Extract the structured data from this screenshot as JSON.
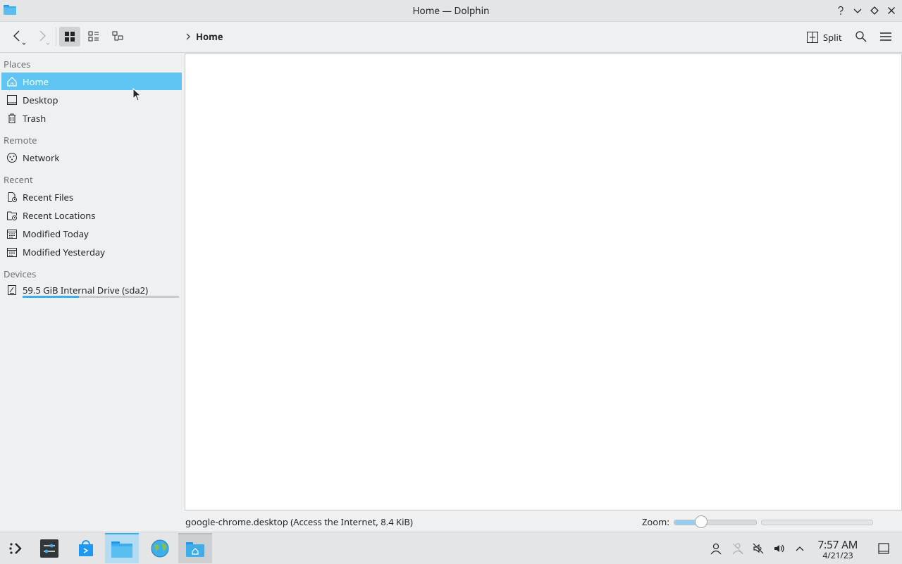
{
  "window": {
    "title": "Home — Dolphin"
  },
  "toolbar": {
    "breadcrumb": "Home",
    "split_label": "Split"
  },
  "sidebar": {
    "sections": {
      "places": "Places",
      "remote": "Remote",
      "recent": "Recent",
      "devices": "Devices"
    },
    "items": {
      "home": "Home",
      "desktop": "Desktop",
      "trash": "Trash",
      "network": "Network",
      "recent_files": "Recent Files",
      "recent_locations": "Recent Locations",
      "modified_today": "Modified Today",
      "modified_yesterday": "Modified Yesterday",
      "drive": "59.5 GiB Internal Drive (sda2)"
    },
    "drive_usage_fraction": 0.36
  },
  "status": {
    "text": "google-chrome.desktop (Access the Internet, 8.4 KiB)",
    "zoom_label": "Zoom:",
    "zoom_fraction": 0.33
  },
  "taskbar": {
    "time": "7:57 AM",
    "date": "4/21/23"
  },
  "colors": {
    "accent": "#3daee9",
    "selection": "#61c5f3"
  }
}
